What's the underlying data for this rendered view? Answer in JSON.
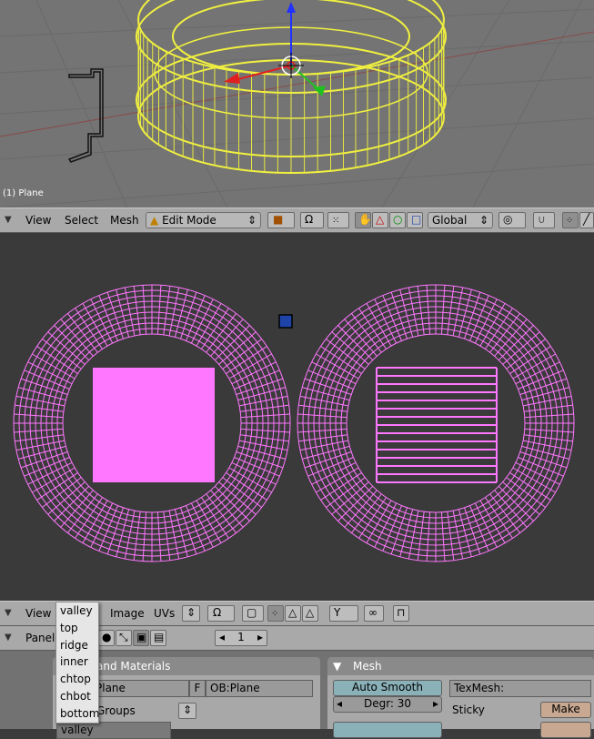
{
  "viewport3d": {
    "object_label": "(1) Plane"
  },
  "header3d": {
    "menus": [
      "View",
      "Select",
      "Mesh"
    ],
    "mode": "Edit Mode",
    "orientation": "Global"
  },
  "uv_header": {
    "menus": [
      "View",
      "Image",
      "UVs"
    ]
  },
  "uv_group_dropdown": {
    "options": [
      "valley",
      "top",
      "ridge",
      "inner",
      "chtop",
      "chbot",
      "bottom"
    ]
  },
  "buttons_header": {
    "panels_label": "Panel",
    "frame": "1"
  },
  "links_panel": {
    "title_fragment": "and Materials",
    "me_field": "Plane",
    "f_label": "F",
    "ob_field": "OB:Plane",
    "vgroups_label": "Groups",
    "vgroup_value": "valley"
  },
  "mesh_panel": {
    "title": "Mesh",
    "auto_smooth": "Auto Smooth",
    "degr": "Degr: 30",
    "texmesh": "TexMesh:",
    "sticky": "Sticky",
    "make": "Make"
  },
  "colors": {
    "wire_yellow": "#f0f040",
    "uv_pink": "#ff77ff",
    "viewport_bg": "#747474",
    "uv_bg": "#3a3a3a",
    "header_bg": "#a9a9a9"
  }
}
